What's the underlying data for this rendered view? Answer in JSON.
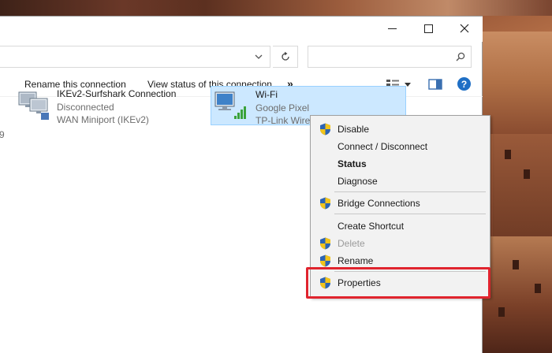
{
  "window": {
    "minimize_icon": "minimize-icon",
    "maximize_icon": "maximize-icon",
    "close_icon": "close-icon"
  },
  "address": {
    "value": "",
    "chevron_icon": "chevron-down-icon",
    "refresh_icon": "refresh-icon"
  },
  "search": {
    "placeholder": "",
    "icon": "search-icon"
  },
  "toolbar": {
    "rename_label": "Rename this connection",
    "view_status_label": "View status of this connection",
    "more_label": "»",
    "view_icon": "view-options-icon",
    "preview_pane_icon": "preview-pane-icon",
    "help_label": "?"
  },
  "connections": [
    {
      "name": "IKEv2-Surfshark Connection",
      "status": "Disconnected",
      "device": "WAN Miniport (IKEv2)",
      "icon": "vpn-connection-icon"
    },
    {
      "name": "Wi-Fi",
      "status": "Google Pixel",
      "device": "TP-Link Wireless",
      "icon": "wifi-adapter-icon"
    }
  ],
  "left_cut_text": "9",
  "context_menu": {
    "items": [
      {
        "label": "Disable",
        "shield": true
      },
      {
        "label": "Connect / Disconnect",
        "shield": false
      },
      {
        "label": "Status",
        "shield": false
      },
      {
        "label": "Diagnose",
        "shield": false
      },
      {
        "label": "Bridge Connections",
        "shield": true
      },
      {
        "label": "Create Shortcut",
        "shield": false
      },
      {
        "label": "Delete",
        "shield": true
      },
      {
        "label": "Rename",
        "shield": true
      },
      {
        "label": "Properties",
        "shield": true
      }
    ]
  },
  "colors": {
    "selection_bg": "#cce8ff",
    "selection_border": "#99d1ff",
    "menu_bg": "#f2f2f2",
    "highlight": "#e0242e",
    "help_blue": "#1f6fc5"
  }
}
